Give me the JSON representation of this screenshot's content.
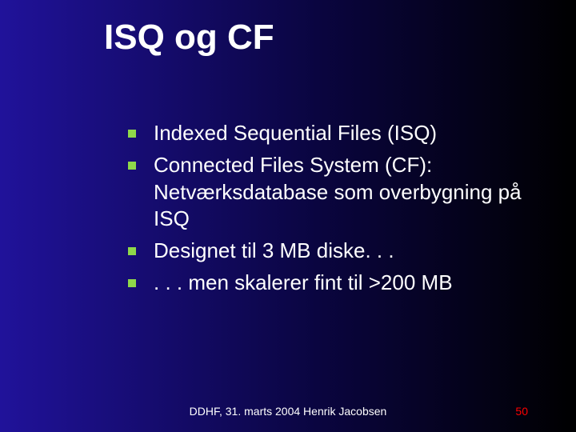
{
  "title": "ISQ og CF",
  "bullets": [
    "Indexed Sequential Files (ISQ)",
    "Connected Files System (CF): Netværksdatabase som overbygning på ISQ",
    "Designet til 3 MB diske. . .",
    ". . . men skalerer fint til >200 MB"
  ],
  "footer": {
    "left": "DDHF, 31. marts 2004   Henrik Jacobsen",
    "page": "50"
  }
}
